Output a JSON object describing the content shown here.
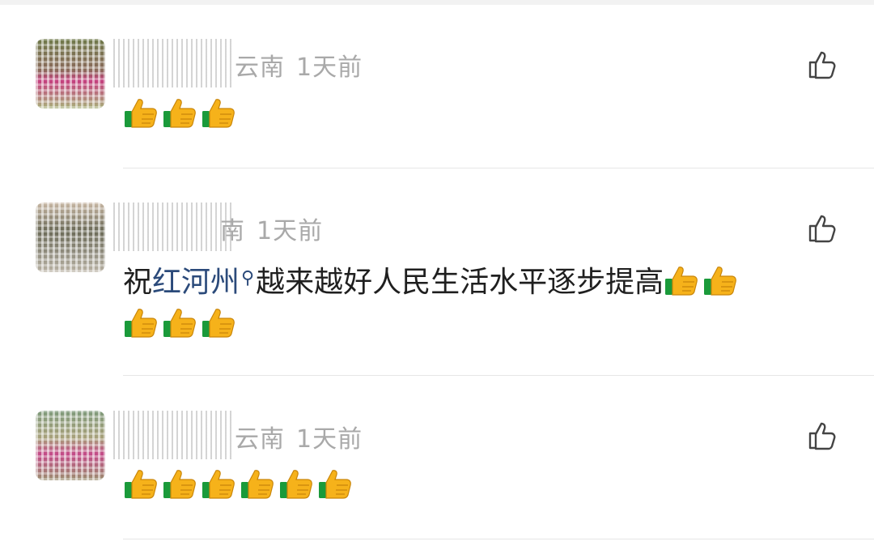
{
  "comments": [
    {
      "location": "云南",
      "time": "1天前",
      "text_pre": "",
      "hashtag": "",
      "text_post": "",
      "thumbs_line1": 3,
      "thumbs_line2": 0
    },
    {
      "location": "南",
      "time": "1天前",
      "text_pre": "祝",
      "hashtag": "红河州",
      "text_post": "越来越好人民生活水平逐步提高",
      "thumbs_line1": 2,
      "thumbs_line2": 3
    },
    {
      "location": "云南",
      "time": "1天前",
      "text_pre": "",
      "hashtag": "",
      "text_post": "",
      "thumbs_line1": 6,
      "thumbs_line2": 0
    }
  ],
  "colors": {
    "meta_gray": "#a9a9a9",
    "hashtag_blue": "#2b4a7a",
    "thumb_yellow": "#f6b21a",
    "cuff_green": "#1a9a3a"
  },
  "icons": {
    "like": "thumbs-up-outline-icon",
    "emoji": "thumbs-up-emoji-icon",
    "hashtag_search": "search-icon"
  }
}
